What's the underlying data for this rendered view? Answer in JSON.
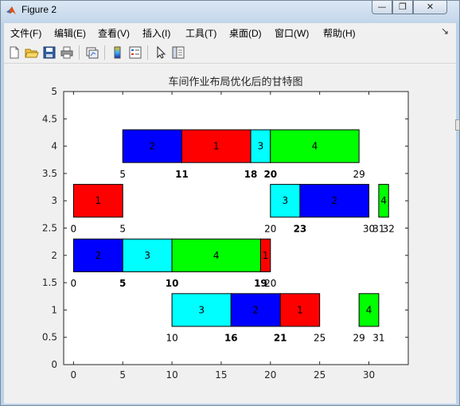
{
  "window": {
    "title": "Figure 2",
    "controls": {
      "minimize": "—",
      "maximize": "❐",
      "close": "✕"
    }
  },
  "menubar": {
    "items": [
      "文件(F)",
      "编辑(E)",
      "查看(V)",
      "插入(I)",
      "工具(T)",
      "桌面(D)",
      "窗口(W)",
      "帮助(H)"
    ],
    "overflow_icon": "arrow-icon"
  },
  "toolbar": {
    "icons": [
      "new-figure-icon",
      "open-file-icon",
      "save-icon",
      "print-icon",
      "link-plot-icon",
      "colorbar-icon",
      "legend-icon",
      "pointer-icon",
      "property-editor-icon"
    ]
  },
  "chart_data": {
    "type": "gantt",
    "title": "车间作业布局优化后的甘特图",
    "xlabel": "",
    "ylabel": "",
    "xlim": [
      -1,
      34
    ],
    "ylim": [
      0,
      5
    ],
    "xticks": [
      "0",
      "5",
      "10",
      "15",
      "20",
      "25",
      "30"
    ],
    "yticks": [
      "0",
      "0.5",
      "1",
      "1.5",
      "2",
      "2.5",
      "3",
      "3.5",
      "4",
      "4.5",
      "5"
    ],
    "grid": false,
    "legend": "none",
    "colors": {
      "1": "#ff0000",
      "2": "#0000ff",
      "3": "#00ffff",
      "4": "#00ff00"
    },
    "machines": [
      {
        "y": 4,
        "tasks": [
          {
            "job": "2",
            "start": 5,
            "end": 11
          },
          {
            "job": "1",
            "start": 11,
            "end": 18
          },
          {
            "job": "3",
            "start": 18,
            "end": 20
          },
          {
            "job": "4",
            "start": 20,
            "end": 29
          }
        ]
      },
      {
        "y": 3,
        "tasks": [
          {
            "job": "1",
            "start": 0,
            "end": 5
          },
          {
            "job": "3",
            "start": 20,
            "end": 23
          },
          {
            "job": "2",
            "start": 23,
            "end": 30
          },
          {
            "job": "4",
            "start": 31,
            "end": 32
          }
        ]
      },
      {
        "y": 2,
        "tasks": [
          {
            "job": "2",
            "start": 0,
            "end": 5
          },
          {
            "job": "3",
            "start": 5,
            "end": 10
          },
          {
            "job": "4",
            "start": 10,
            "end": 19
          },
          {
            "job": "1",
            "start": 19,
            "end": 20
          }
        ]
      },
      {
        "y": 1,
        "tasks": [
          {
            "job": "3",
            "start": 10,
            "end": 16
          },
          {
            "job": "2",
            "start": 16,
            "end": 21
          },
          {
            "job": "1",
            "start": 21,
            "end": 25
          },
          {
            "job": "4",
            "start": 29,
            "end": 31
          }
        ]
      }
    ],
    "time_labels": [
      {
        "y": 4,
        "labels": [
          {
            "x": 5,
            "text": "5",
            "bold": false
          },
          {
            "x": 11,
            "text": "11",
            "bold": true
          },
          {
            "x": 18,
            "text": "18",
            "bold": true
          },
          {
            "x": 20,
            "text": "20",
            "bold": true
          },
          {
            "x": 29,
            "text": "29",
            "bold": false
          }
        ]
      },
      {
        "y": 3,
        "labels": [
          {
            "x": 0,
            "text": "0",
            "bold": false
          },
          {
            "x": 5,
            "text": "5",
            "bold": false
          },
          {
            "x": 20,
            "text": "20",
            "bold": false
          },
          {
            "x": 23,
            "text": "23",
            "bold": true
          },
          {
            "x": 30,
            "text": "30",
            "bold": false
          },
          {
            "x": 31,
            "text": "31",
            "bold": false
          },
          {
            "x": 32,
            "text": "32",
            "bold": false
          }
        ]
      },
      {
        "y": 2,
        "labels": [
          {
            "x": 0,
            "text": "0",
            "bold": false
          },
          {
            "x": 5,
            "text": "5",
            "bold": true
          },
          {
            "x": 10,
            "text": "10",
            "bold": true
          },
          {
            "x": 19,
            "text": "19",
            "bold": true
          },
          {
            "x": 20,
            "text": "20",
            "bold": false
          }
        ]
      },
      {
        "y": 1,
        "labels": [
          {
            "x": 10,
            "text": "10",
            "bold": false
          },
          {
            "x": 16,
            "text": "16",
            "bold": true
          },
          {
            "x": 21,
            "text": "21",
            "bold": true
          },
          {
            "x": 25,
            "text": "25",
            "bold": false
          },
          {
            "x": 29,
            "text": "29",
            "bold": false
          },
          {
            "x": 31,
            "text": "31",
            "bold": false
          }
        ]
      }
    ]
  }
}
